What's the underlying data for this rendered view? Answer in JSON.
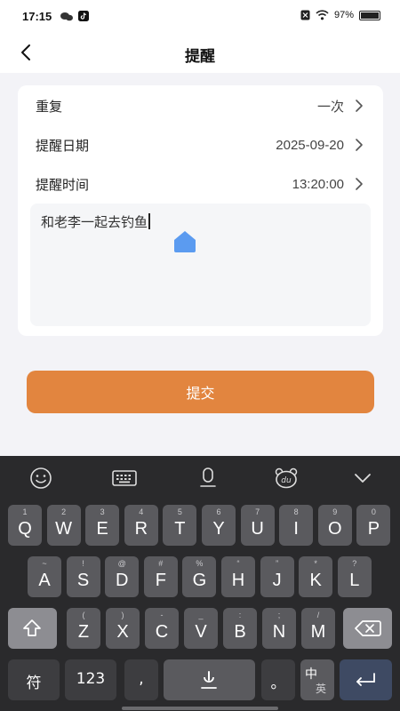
{
  "status": {
    "time": "17:15",
    "battery": "97%"
  },
  "header": {
    "title": "提醒"
  },
  "form": {
    "rows": [
      {
        "label": "重复",
        "value": "一次"
      },
      {
        "label": "提醒日期",
        "value": "2025-09-20"
      },
      {
        "label": "提醒时间",
        "value": "13:20:00"
      }
    ],
    "note": "和老李一起去钓鱼"
  },
  "submit": {
    "label": "提交"
  },
  "keyboard": {
    "row1": [
      {
        "h": "1",
        "k": "Q"
      },
      {
        "h": "2",
        "k": "W"
      },
      {
        "h": "3",
        "k": "E"
      },
      {
        "h": "4",
        "k": "R"
      },
      {
        "h": "5",
        "k": "T"
      },
      {
        "h": "6",
        "k": "Y"
      },
      {
        "h": "7",
        "k": "U"
      },
      {
        "h": "8",
        "k": "I"
      },
      {
        "h": "9",
        "k": "O"
      },
      {
        "h": "0",
        "k": "P"
      }
    ],
    "row2": [
      {
        "h": "~",
        "k": "A"
      },
      {
        "h": "!",
        "k": "S"
      },
      {
        "h": "@",
        "k": "D"
      },
      {
        "h": "#",
        "k": "F"
      },
      {
        "h": "%",
        "k": "G"
      },
      {
        "h": "“",
        "k": "H"
      },
      {
        "h": "”",
        "k": "J"
      },
      {
        "h": "*",
        "k": "K"
      },
      {
        "h": "?",
        "k": "L"
      }
    ],
    "row3": [
      {
        "h": "(",
        "k": "Z"
      },
      {
        "h": ")",
        "k": "X"
      },
      {
        "h": "-",
        "k": "C"
      },
      {
        "h": "_",
        "k": "V"
      },
      {
        "h": ":",
        "k": "B"
      },
      {
        "h": ";",
        "k": "N"
      },
      {
        "h": "/",
        "k": "M"
      }
    ],
    "symbols_label": "符",
    "numbers_label": "123",
    "comma": ",",
    "period": "。",
    "lang_primary": "中",
    "lang_secondary": "英"
  },
  "icons": {
    "back": "chevron-left-icon",
    "row_arrow": "chevron-right-icon",
    "emoji": "emoji-icon",
    "keyboard": "keyboard-icon",
    "mic": "microphone-icon",
    "baidu": "baidu-bear-icon",
    "collapse": "chevron-down-icon",
    "shift": "shift-icon",
    "backspace": "backspace-icon",
    "enter": "enter-icon"
  },
  "colors": {
    "accent": "#e2853f",
    "cursor_handle": "#5b9bf0",
    "keyboard_bg": "#2a2a2c"
  }
}
